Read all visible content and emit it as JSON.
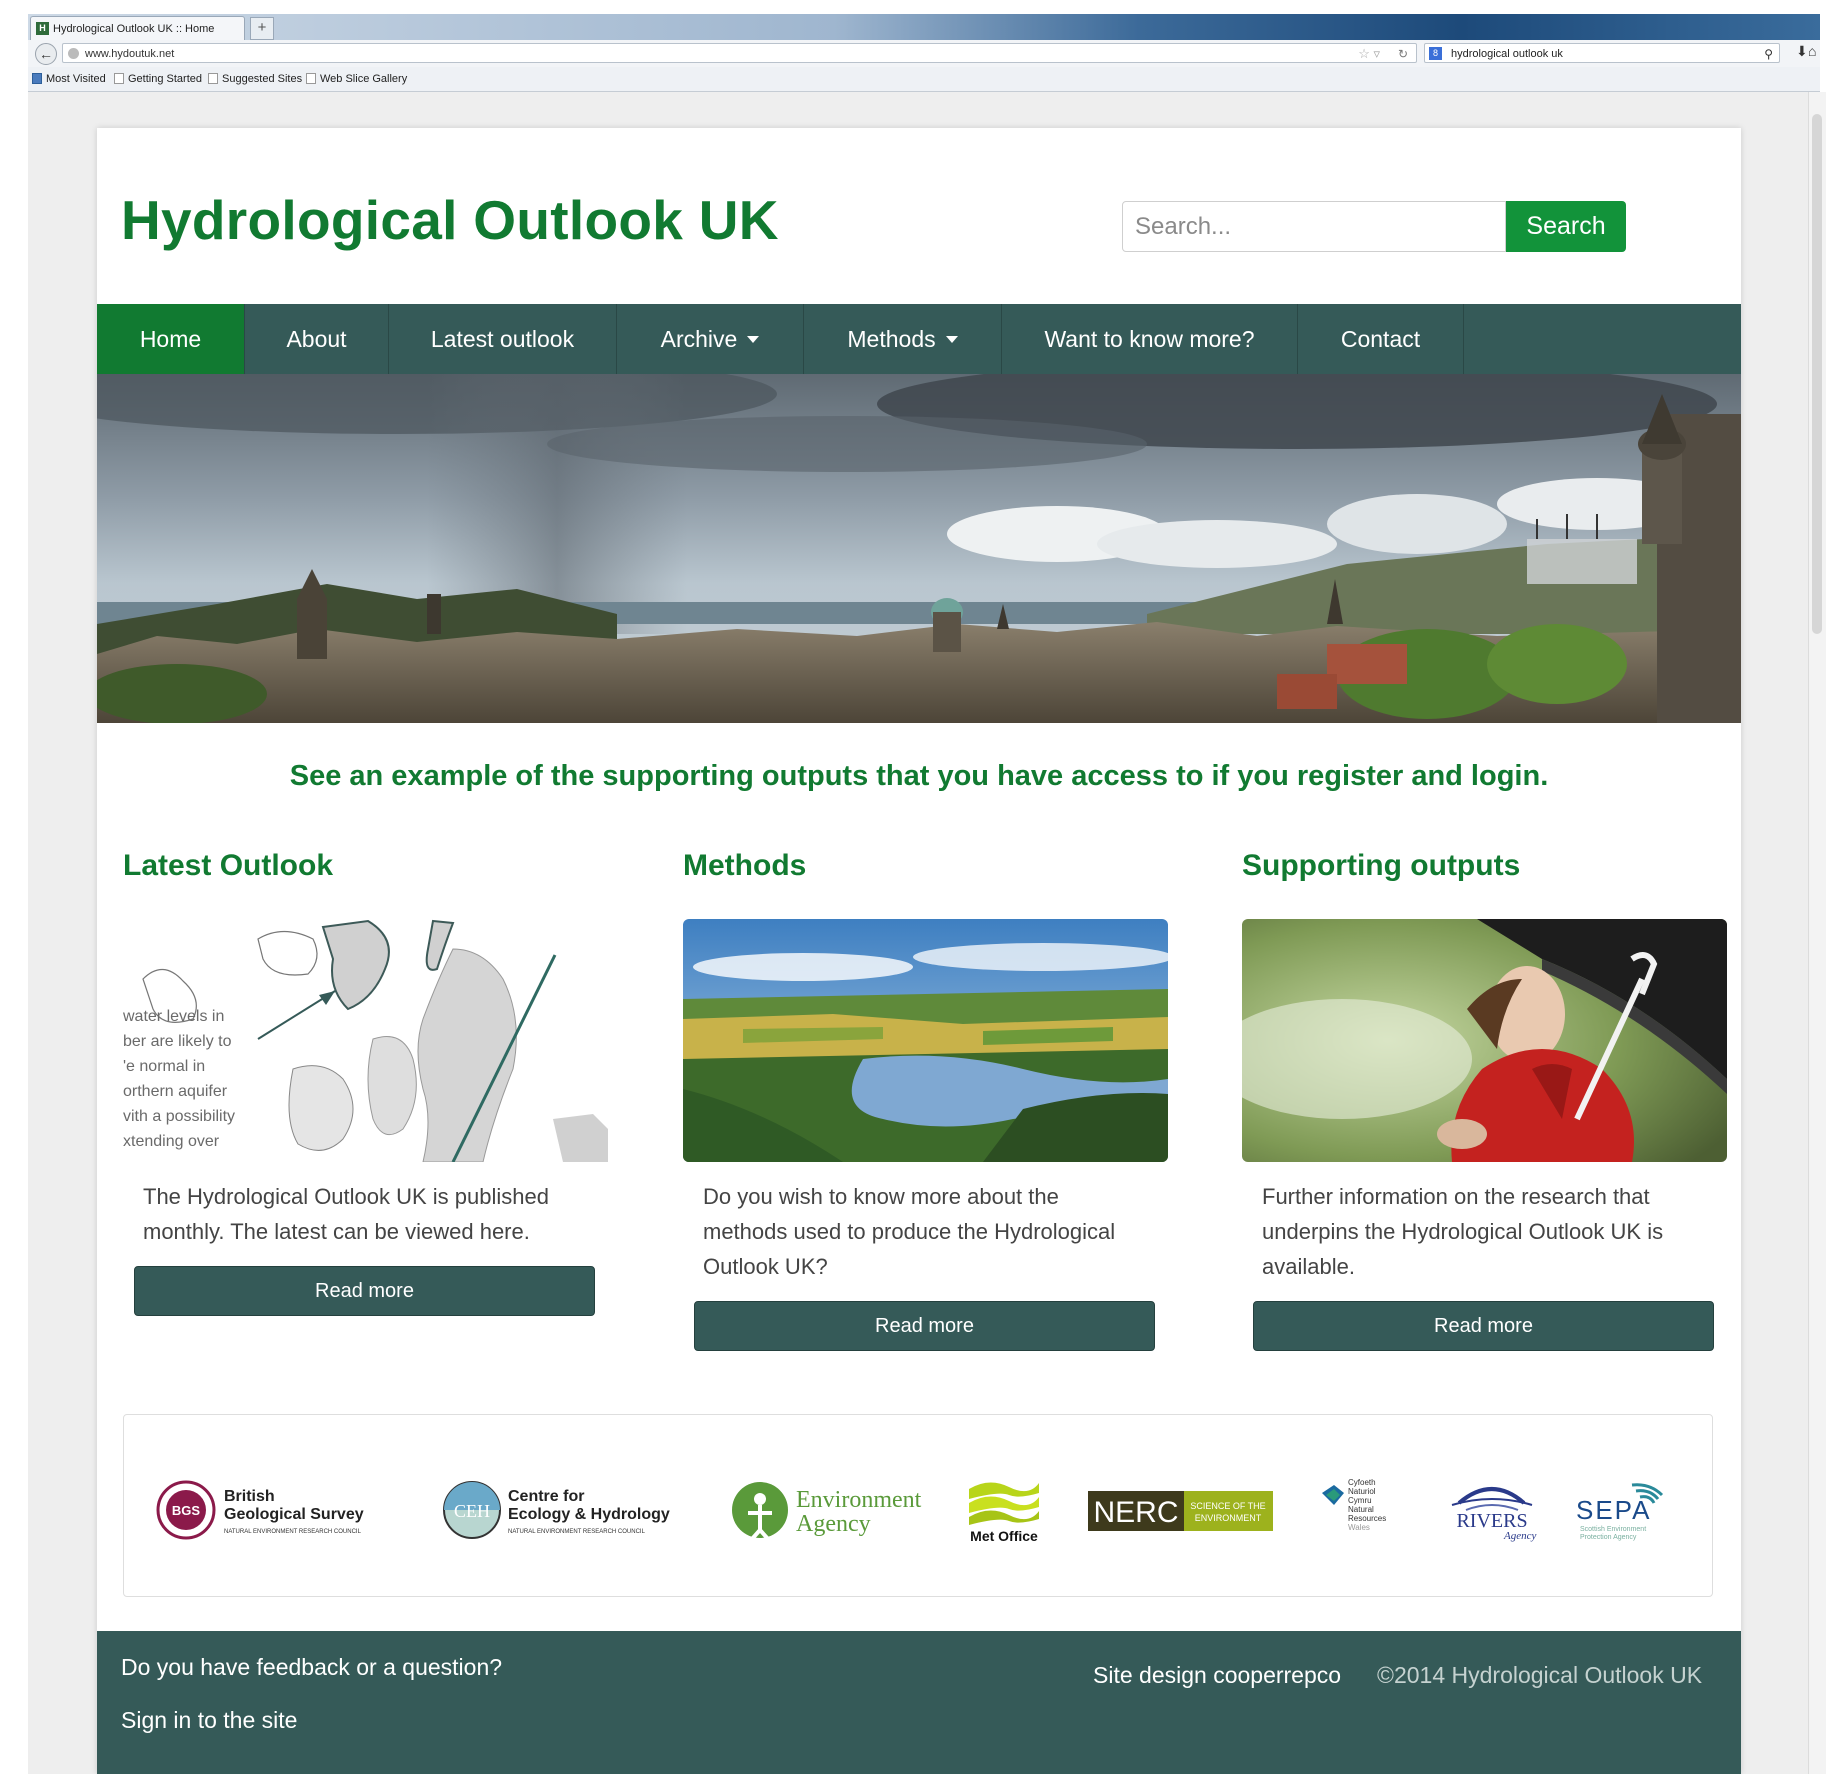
{
  "browser": {
    "tab_title": "Hydrological Outlook UK :: Home",
    "new_tab": "+",
    "url": "www.hydoutuk.net",
    "search_engine_query": "hydrological outlook uk",
    "bookmarks": [
      "Most Visited",
      "Getting Started",
      "Suggested Sites",
      "Web Slice Gallery"
    ]
  },
  "header": {
    "site_title": "Hydrological Outlook UK",
    "search_placeholder": "Search...",
    "search_button": "Search"
  },
  "nav": {
    "items": [
      {
        "label": "Home",
        "active": true
      },
      {
        "label": "About"
      },
      {
        "label": "Latest outlook"
      },
      {
        "label": "Archive",
        "dropdown": true
      },
      {
        "label": "Methods",
        "dropdown": true
      },
      {
        "label": "Want to know more?"
      },
      {
        "label": "Contact"
      }
    ]
  },
  "tagline": "See an example of the supporting outputs that you have access to if you register and login.",
  "columns": [
    {
      "title": "Latest Outlook",
      "image_text": [
        "water levels in",
        "ber are likely to",
        "'e normal in",
        "orthern aquifer",
        "vith a possibility",
        "xtending over"
      ],
      "text": "The Hydrological Outlook UK is published monthly. The latest can be viewed here.",
      "button": "Read more"
    },
    {
      "title": "Methods",
      "text": "Do you wish to know more about the methods used to produce the Hydrological Outlook UK?",
      "button": "Read more"
    },
    {
      "title": "Supporting outputs",
      "text": "Further information on the research that underpins the Hydrological Outlook UK is available.",
      "button": "Read more"
    }
  ],
  "partners": {
    "bgs": {
      "line1": "British",
      "line2": "Geological Survey",
      "sub": "NATURAL ENVIRONMENT RESEARCH COUNCIL",
      "badge": "BGS"
    },
    "ceh": {
      "line1": "Centre for",
      "line2": "Ecology & Hydrology",
      "sub": "NATURAL ENVIRONMENT RESEARCH COUNCIL",
      "badge": "CEH"
    },
    "ea": {
      "line1": "Environment",
      "line2": "Agency"
    },
    "metoffice": {
      "label": "Met Office"
    },
    "nerc": {
      "label": "NERC",
      "sub1": "SCIENCE OF THE",
      "sub2": "ENVIRONMENT"
    },
    "nrw": {
      "lines": [
        "Cyfoeth",
        "Naturiol",
        "Cymru",
        "Natural",
        "Resources",
        "Wales"
      ]
    },
    "rivers": {
      "label": "RIVERS",
      "sub": "Agency"
    },
    "sepa": {
      "label": "SEPA",
      "sub1": "Scottish Environment",
      "sub2": "Protection Agency"
    }
  },
  "footer": {
    "feedback": "Do you have feedback or a question?",
    "signin": "Sign in to the site",
    "design": "Site design cooperrepco",
    "copyright": "©2014 Hydrological Outlook UK"
  },
  "colors": {
    "brand_green": "#117a31",
    "button_green": "#12933a",
    "nav_teal": "#355a58"
  }
}
